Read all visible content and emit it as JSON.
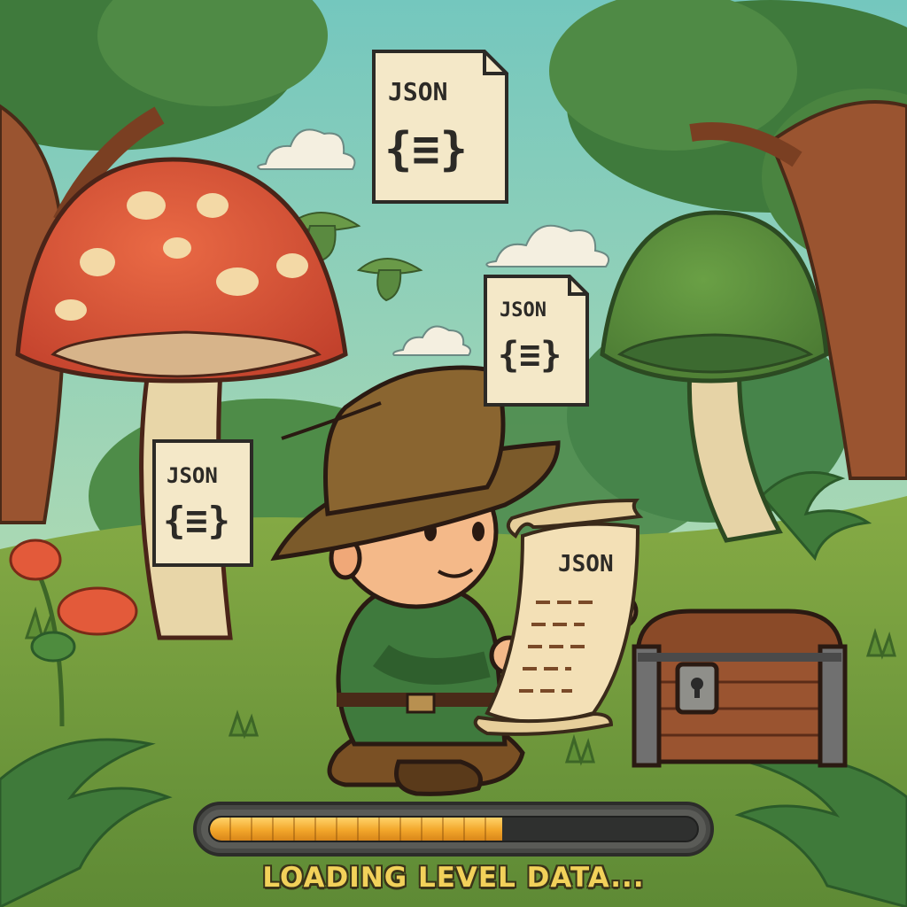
{
  "loading": {
    "label": "LOADING LEVEL DATA...",
    "progress": 0.6
  },
  "floating_docs": [
    {
      "label": "JSON",
      "glyph": "{≡}"
    },
    {
      "label": "JSON",
      "glyph": "{≡}"
    },
    {
      "label": "JSON",
      "glyph": "{≡}"
    }
  ],
  "scroll": {
    "label": "JSON"
  },
  "colors": {
    "sky": "#7cc9bd",
    "grass": "#6f9a3c",
    "progress_fill": "#f2a62a",
    "label_text": "#f2d15a",
    "red_mushroom": "#d9533a",
    "green_mushroom": "#5f8f3e",
    "hat": "#7b5a2a",
    "tunic": "#3f7a3d"
  },
  "icons": [
    "json-file-icon",
    "scroll-icon",
    "treasure-chest-icon",
    "mushroom-icon"
  ]
}
